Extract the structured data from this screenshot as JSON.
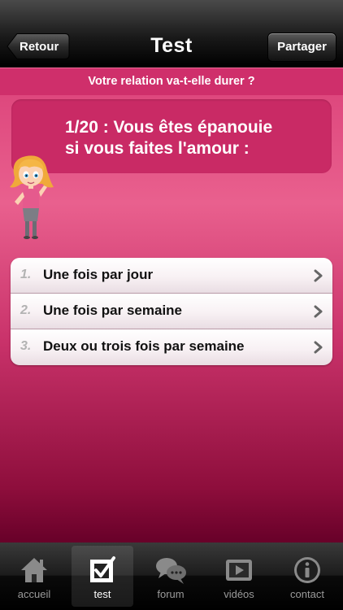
{
  "navbar": {
    "title": "Test",
    "back_label": "Retour",
    "share_label": "Partager"
  },
  "subheader": "Votre relation va-t-elle durer ?",
  "question": {
    "line1": "1/20 : Vous êtes épanouie",
    "line2": "si vous faites l'amour :"
  },
  "answers": [
    {
      "num": "1.",
      "label": "Une fois par jour"
    },
    {
      "num": "2.",
      "label": "Une fois par semaine"
    },
    {
      "num": "3.",
      "label": "Deux ou trois fois par semaine"
    }
  ],
  "tabs": [
    {
      "label": "accueil",
      "icon": "home-icon"
    },
    {
      "label": "test",
      "icon": "checkbox-icon",
      "active": true
    },
    {
      "label": "forum",
      "icon": "speech-bubbles-icon"
    },
    {
      "label": "vidéos",
      "icon": "video-play-icon"
    },
    {
      "label": "contact",
      "icon": "info-icon"
    }
  ],
  "colors": {
    "accent_pink": "#cf2f6b",
    "question_box": "#c92a65"
  }
}
